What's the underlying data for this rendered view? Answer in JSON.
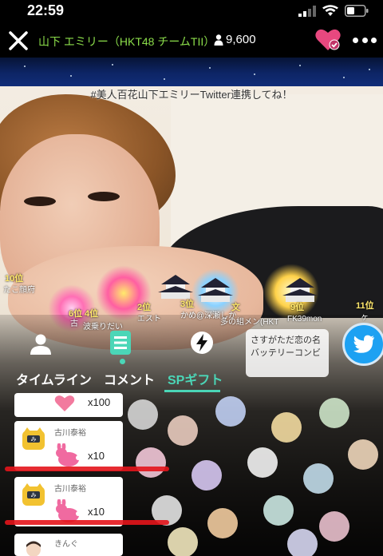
{
  "status_bar": {
    "time": "22:59"
  },
  "header": {
    "room_title": "山下 エミリー（HKT48 チームTII）",
    "viewer_count": "9,600"
  },
  "stream": {
    "hashtag_banner": "#美人百花山下エミリーTwitter連携してね！"
  },
  "ranking": [
    {
      "rank": "10位",
      "name": "たこ顔府"
    },
    {
      "rank": "6位",
      "name": "古"
    },
    {
      "rank": "4位",
      "name": "波乗りだい"
    },
    {
      "rank": "2位",
      "name": "エスト"
    },
    {
      "rank": "3位",
      "name": "かめ@深瀬しか"
    },
    {
      "rank": "文",
      "name": "多の組メン(HKT"
    },
    {
      "rank": "9位",
      "name": "FK39mon"
    },
    {
      "rank": "11位",
      "name": "ヶ"
    }
  ],
  "speech_bubble": {
    "text": "さすがただ恋の名バッテリーコンビ"
  },
  "tabs": [
    {
      "label": "タイムライン",
      "active": false
    },
    {
      "label": "コメント",
      "active": false
    },
    {
      "label": "SPギフト",
      "active": true
    }
  ],
  "gifts": [
    {
      "name": "",
      "qty": "x100",
      "gift": "heart"
    },
    {
      "name": "古川泰裕",
      "qty": "x10",
      "gift": "pink-bunny"
    },
    {
      "name": "古川泰裕",
      "qty": "x10",
      "gift": "pink-bunny"
    },
    {
      "name": "きんぐ",
      "qty": "",
      "gift": ""
    }
  ],
  "colors": {
    "accent": "#4bd6b7",
    "title_green": "#8bdd4a",
    "twitter_blue": "#1da1f2",
    "follow_pink": "#e8487f",
    "highlight_red": "#e3141b"
  }
}
